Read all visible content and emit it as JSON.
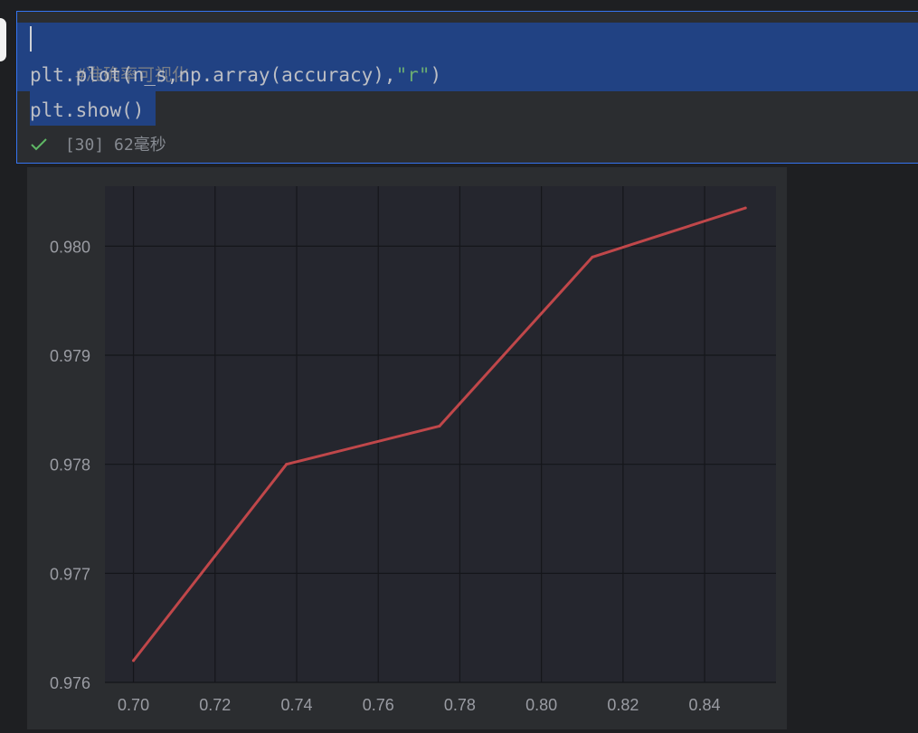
{
  "cell": {
    "lines": [
      {
        "comment": "#准确率可视化"
      },
      {
        "code_prefix": "plt.plot(n_s,np.array(accuracy),",
        "string": "\"r\"",
        "code_suffix": ")"
      },
      {
        "code": "plt.show()"
      }
    ],
    "status": {
      "icon": "check-icon",
      "exec_count": "[30]",
      "duration": "62毫秒"
    }
  },
  "colors": {
    "selection": "#214283",
    "line": "#c0474a",
    "string": "#6aab73",
    "check": "#5fb865"
  },
  "chart_data": {
    "type": "line",
    "title": "",
    "xlabel": "",
    "ylabel": "",
    "x": [
      0.7,
      0.7375,
      0.775,
      0.8125,
      0.85
    ],
    "series": [
      {
        "values": [
          0.9762,
          0.978,
          0.97835,
          0.9799,
          0.98035
        ],
        "color": "#c0474a"
      }
    ],
    "xlim": [
      0.693,
      0.8575
    ],
    "ylim": [
      0.976,
      0.98055
    ],
    "xticks": [
      "0.70",
      "0.72",
      "0.74",
      "0.76",
      "0.78",
      "0.80",
      "0.82",
      "0.84"
    ],
    "xtick_values": [
      0.7,
      0.72,
      0.74,
      0.76,
      0.78,
      0.8,
      0.82,
      0.84
    ],
    "yticks": [
      "0.976",
      "0.977",
      "0.978",
      "0.979",
      "0.980"
    ],
    "ytick_values": [
      0.976,
      0.977,
      0.978,
      0.979,
      0.98
    ],
    "grid": true
  }
}
